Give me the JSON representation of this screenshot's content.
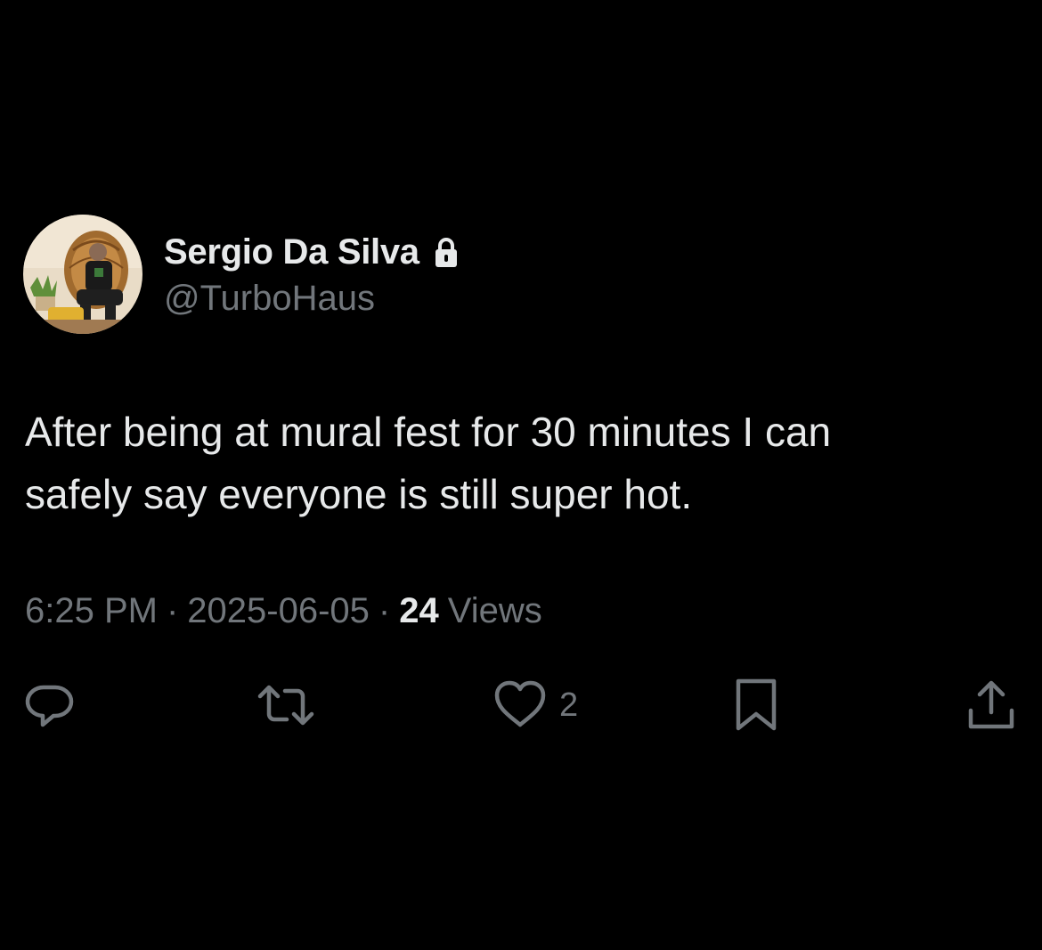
{
  "author": {
    "display_name": "Sergio Da Silva",
    "handle": "@TurboHaus",
    "protected_icon": "lock-icon",
    "avatar": "profile-photo"
  },
  "tweet": {
    "text_lines": [
      "After being at mural fest for 30 minutes I can",
      "safely say everyone is still super hot."
    ]
  },
  "meta": {
    "time": "6:25 PM",
    "separator": "·",
    "date": "2025-06-05",
    "views_count": "24",
    "views_label": "Views"
  },
  "actions": {
    "reply": {
      "icon": "reply-icon"
    },
    "retweet": {
      "icon": "retweet-icon"
    },
    "like": {
      "icon": "heart-icon",
      "count": "2"
    },
    "bookmark": {
      "icon": "bookmark-icon"
    },
    "share": {
      "icon": "share-icon"
    }
  },
  "colors": {
    "background": "#000000",
    "primary_text": "#e7e9ea",
    "secondary_text": "#71767b"
  }
}
